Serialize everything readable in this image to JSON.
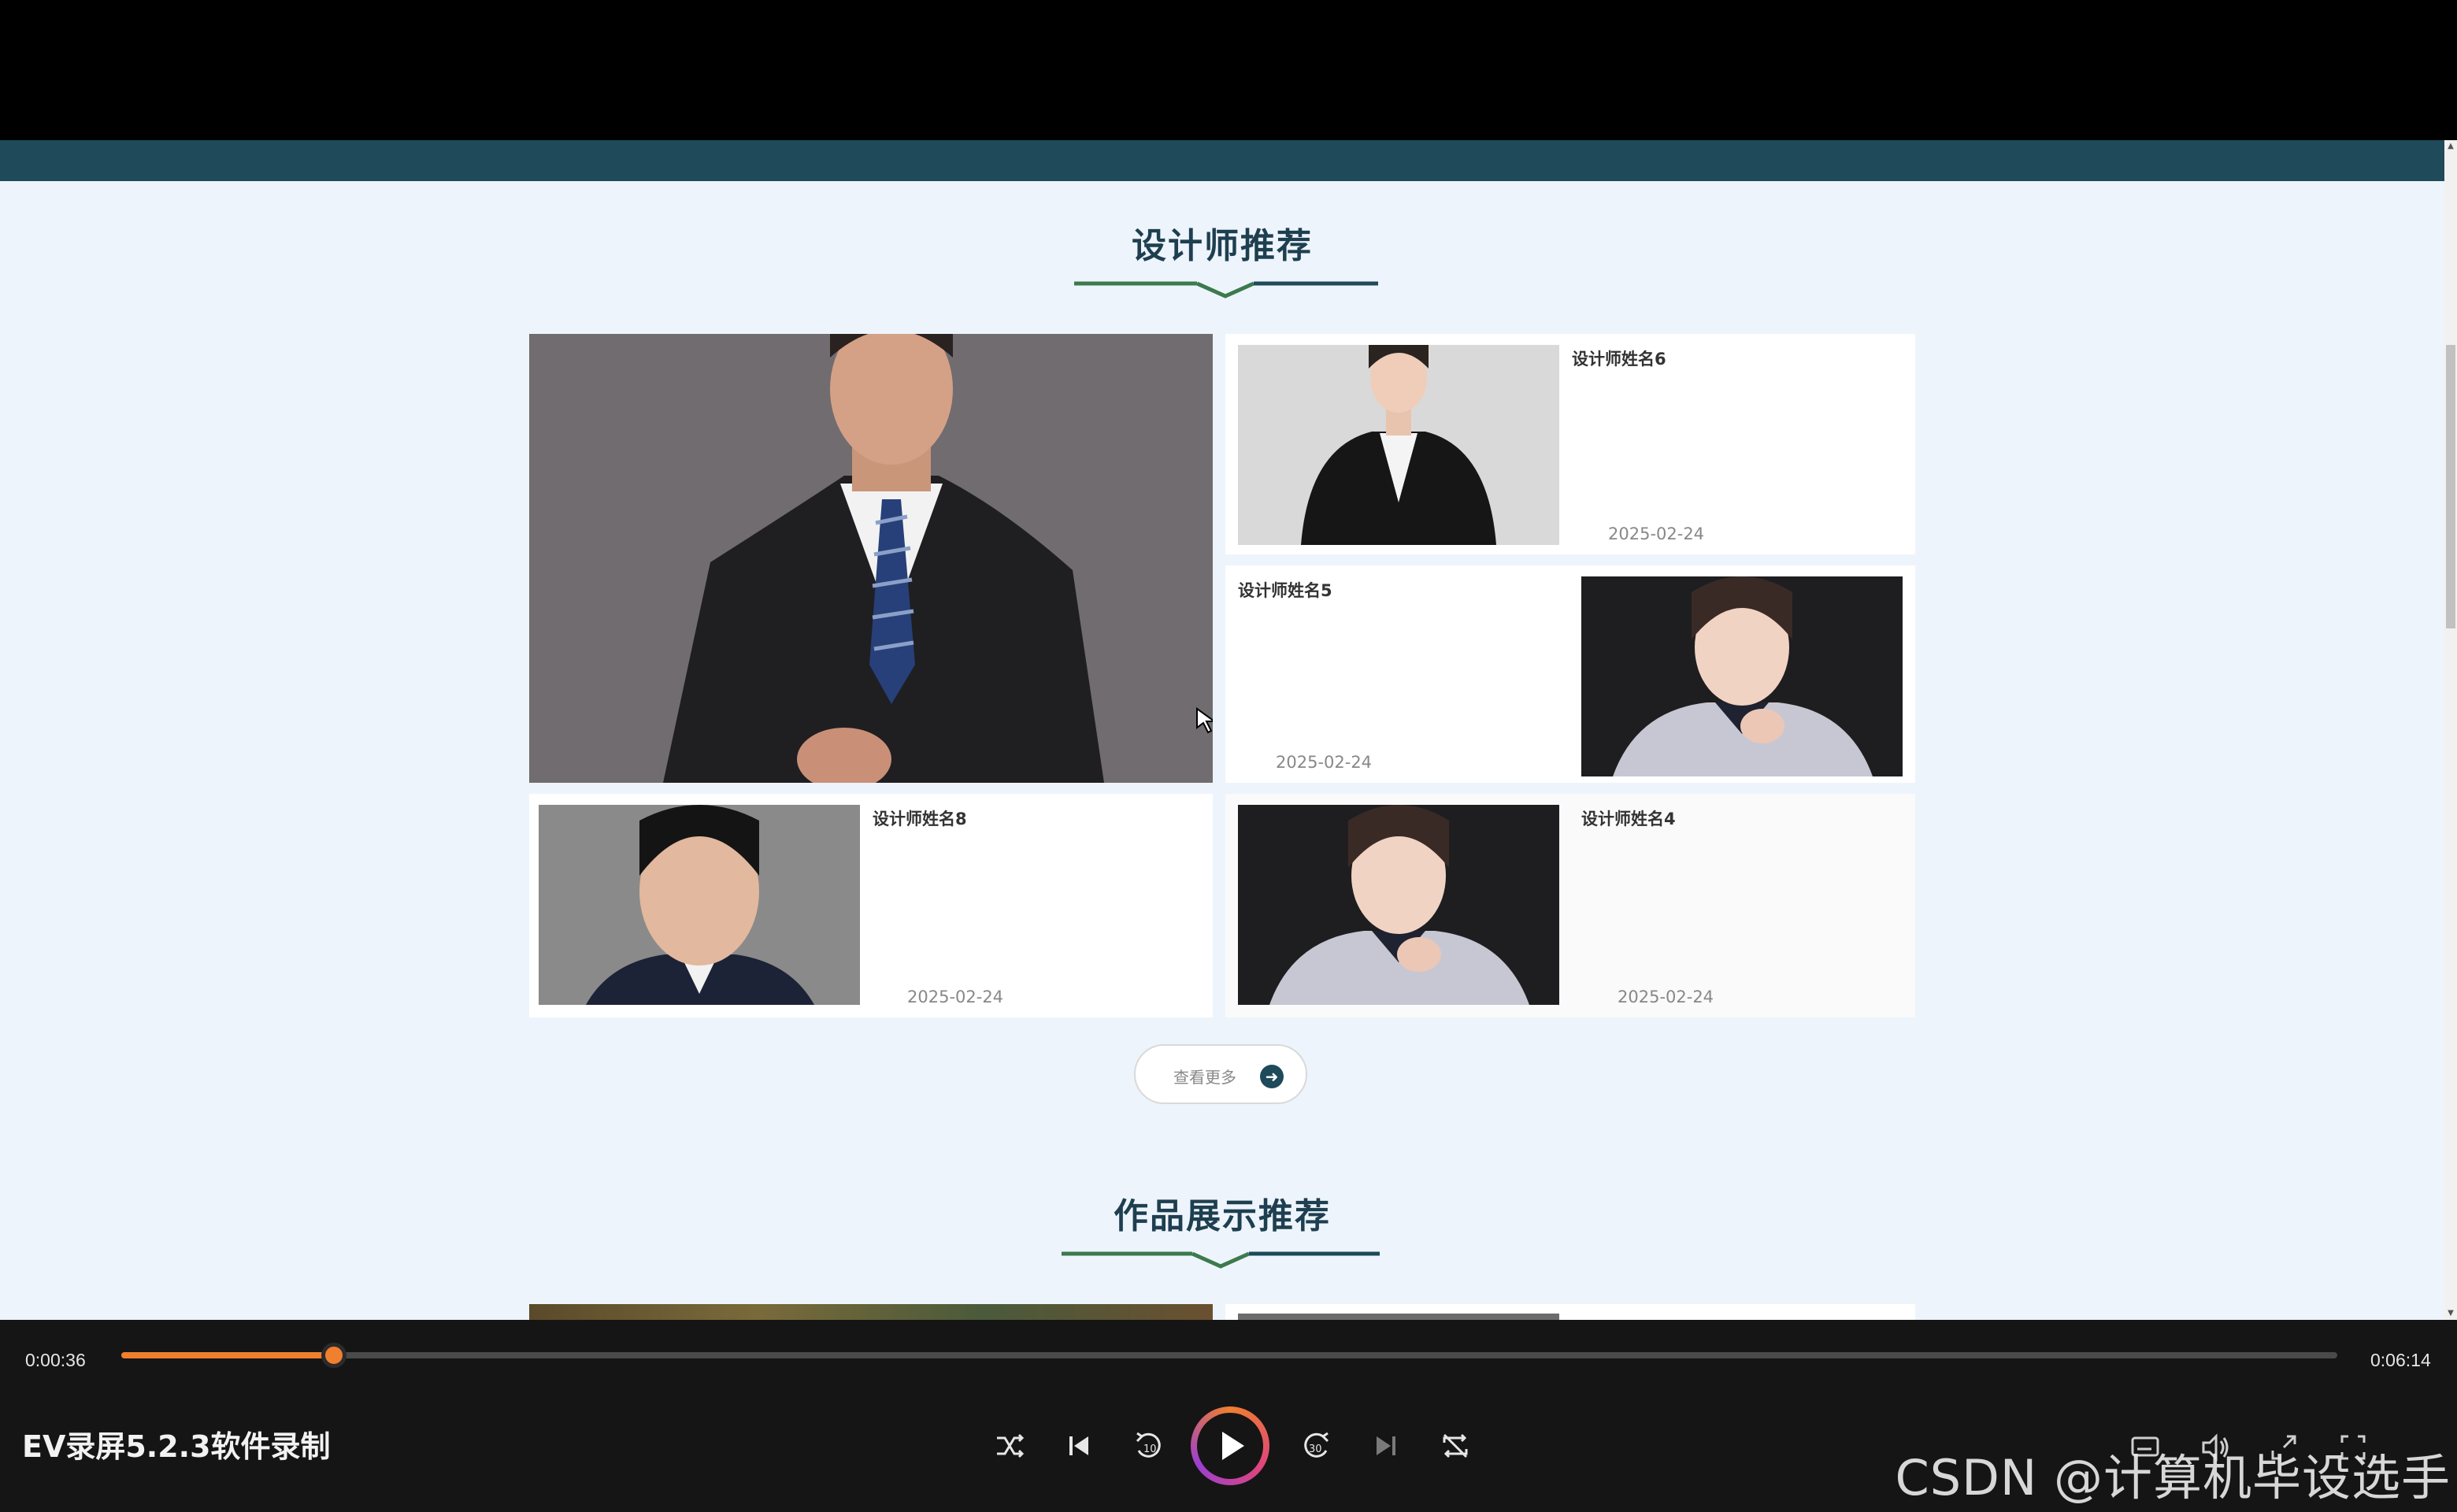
{
  "website": {
    "section1_title": "设计师推荐",
    "section2_title": "作品展示推荐",
    "designers": [
      {
        "name": "设计师姓名6",
        "date": "2025-02-24"
      },
      {
        "name": "设计师姓名5",
        "date": "2025-02-24"
      },
      {
        "name": "设计师姓名8",
        "date": "2025-02-24"
      },
      {
        "name": "设计师姓名4",
        "date": "2025-02-24"
      }
    ],
    "more_button": "查看更多",
    "colors": {
      "accent": "#1e4a5a",
      "title": "#1e3f50",
      "deco": "#3c7a4e",
      "background": "#eef4fb"
    }
  },
  "player": {
    "current_time": "0:00:36",
    "total_time": "0:06:14",
    "progress": 0.096,
    "title": "EV录屏5.2.3软件录制",
    "watermark": "CSDN @计算机毕设选手",
    "controls": [
      "shuffle-icon",
      "previous-icon",
      "rewind-10-icon",
      "play-icon",
      "forward-30-icon",
      "next-icon",
      "repeat-off-icon",
      "subtitle-icon",
      "volume-icon",
      "expand-icon",
      "fullscreen-icon"
    ],
    "colors": {
      "progress": "#f07f2e",
      "background": "#151515"
    }
  }
}
